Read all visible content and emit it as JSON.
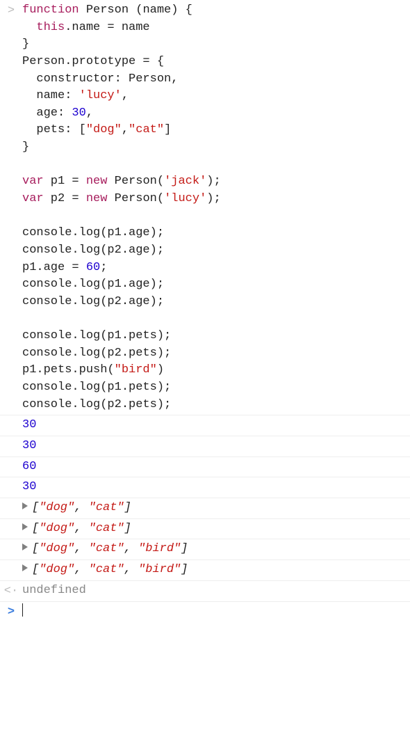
{
  "input": {
    "marker": ">",
    "lines": [
      [
        {
          "cls": "kw",
          "t": "function"
        },
        {
          "cls": "punct",
          "t": " "
        },
        {
          "cls": "fn",
          "t": "Person"
        },
        {
          "cls": "punct",
          "t": " ("
        },
        {
          "cls": "prop",
          "t": "name"
        },
        {
          "cls": "punct",
          "t": ") {"
        }
      ],
      [
        {
          "cls": "punct",
          "t": "  "
        },
        {
          "cls": "kw",
          "t": "this"
        },
        {
          "cls": "punct",
          "t": ".name = name"
        }
      ],
      [
        {
          "cls": "punct",
          "t": "}"
        }
      ],
      [
        {
          "cls": "fn",
          "t": "Person"
        },
        {
          "cls": "punct",
          "t": ".prototype = {"
        }
      ],
      [
        {
          "cls": "punct",
          "t": "  constructor: Person,"
        }
      ],
      [
        {
          "cls": "punct",
          "t": "  name: "
        },
        {
          "cls": "str",
          "t": "'lucy'"
        },
        {
          "cls": "punct",
          "t": ","
        }
      ],
      [
        {
          "cls": "punct",
          "t": "  age: "
        },
        {
          "cls": "num",
          "t": "30"
        },
        {
          "cls": "punct",
          "t": ","
        }
      ],
      [
        {
          "cls": "punct",
          "t": "  pets: ["
        },
        {
          "cls": "str",
          "t": "\"dog\""
        },
        {
          "cls": "punct",
          "t": ","
        },
        {
          "cls": "str",
          "t": "\"cat\""
        },
        {
          "cls": "punct",
          "t": "]"
        }
      ],
      [
        {
          "cls": "punct",
          "t": "}"
        }
      ],
      [
        {
          "cls": "punct",
          "t": ""
        }
      ],
      [
        {
          "cls": "kw",
          "t": "var"
        },
        {
          "cls": "punct",
          "t": " p1 = "
        },
        {
          "cls": "kw",
          "t": "new"
        },
        {
          "cls": "punct",
          "t": " Person("
        },
        {
          "cls": "str",
          "t": "'jack'"
        },
        {
          "cls": "punct",
          "t": ");"
        }
      ],
      [
        {
          "cls": "kw",
          "t": "var"
        },
        {
          "cls": "punct",
          "t": " p2 = "
        },
        {
          "cls": "kw",
          "t": "new"
        },
        {
          "cls": "punct",
          "t": " Person("
        },
        {
          "cls": "str",
          "t": "'lucy'"
        },
        {
          "cls": "punct",
          "t": ");"
        }
      ],
      [
        {
          "cls": "punct",
          "t": ""
        }
      ],
      [
        {
          "cls": "punct",
          "t": "console.log(p1.age);"
        }
      ],
      [
        {
          "cls": "punct",
          "t": "console.log(p2.age);"
        }
      ],
      [
        {
          "cls": "punct",
          "t": "p1.age = "
        },
        {
          "cls": "num",
          "t": "60"
        },
        {
          "cls": "punct",
          "t": ";"
        }
      ],
      [
        {
          "cls": "punct",
          "t": "console.log(p1.age);"
        }
      ],
      [
        {
          "cls": "punct",
          "t": "console.log(p2.age);"
        }
      ],
      [
        {
          "cls": "punct",
          "t": ""
        }
      ],
      [
        {
          "cls": "punct",
          "t": "console.log(p1.pets);"
        }
      ],
      [
        {
          "cls": "punct",
          "t": "console.log(p2.pets);"
        }
      ],
      [
        {
          "cls": "punct",
          "t": "p1.pets.push("
        },
        {
          "cls": "str",
          "t": "\"bird\""
        },
        {
          "cls": "punct",
          "t": ")"
        }
      ],
      [
        {
          "cls": "punct",
          "t": "console.log(p1.pets);"
        }
      ],
      [
        {
          "cls": "punct",
          "t": "console.log(p2.pets);"
        }
      ]
    ]
  },
  "outputs": [
    {
      "type": "number",
      "value": "30"
    },
    {
      "type": "number",
      "value": "30"
    },
    {
      "type": "number",
      "value": "60"
    },
    {
      "type": "number",
      "value": "30"
    },
    {
      "type": "array",
      "items": [
        "\"dog\"",
        "\"cat\""
      ]
    },
    {
      "type": "array",
      "items": [
        "\"dog\"",
        "\"cat\""
      ]
    },
    {
      "type": "array",
      "items": [
        "\"dog\"",
        "\"cat\"",
        "\"bird\""
      ]
    },
    {
      "type": "array",
      "items": [
        "\"dog\"",
        "\"cat\"",
        "\"bird\""
      ]
    }
  ],
  "return": {
    "marker": "<·",
    "value": "undefined"
  },
  "prompt": {
    "marker": ">"
  }
}
